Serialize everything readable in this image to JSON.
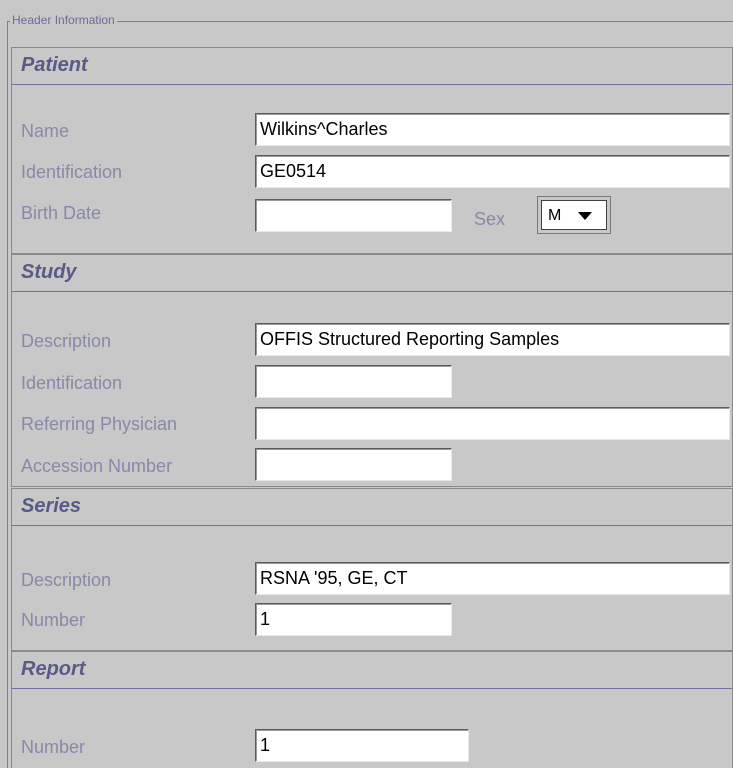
{
  "group": {
    "title": "Header Information"
  },
  "patient": {
    "title": "Patient",
    "name_label": "Name",
    "name_value": "Wilkins^Charles",
    "id_label": "Identification",
    "id_value": "GE0514",
    "birth_label": "Birth Date",
    "birth_value": "",
    "sex_label": "Sex",
    "sex_value": "M"
  },
  "study": {
    "title": "Study",
    "desc_label": "Description",
    "desc_value": "OFFIS Structured Reporting Samples",
    "id_label": "Identification",
    "id_value": "",
    "ref_label": "Referring Physician",
    "ref_value": "",
    "acc_label": "Accession Number",
    "acc_value": ""
  },
  "series": {
    "title": "Series",
    "desc_label": "Description",
    "desc_value": "RSNA '95, GE, CT",
    "number_label": "Number",
    "number_value": "1"
  },
  "report": {
    "title": "Report",
    "number_label": "Number",
    "number_value": "1"
  }
}
